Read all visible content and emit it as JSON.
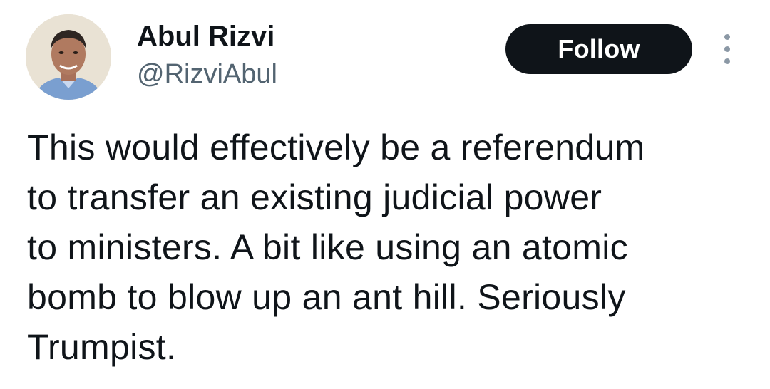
{
  "author": {
    "display_name": "Abul Rizvi",
    "handle": "@RizviAbul",
    "avatar_icon": "profile-photo"
  },
  "actions": {
    "follow_label": "Follow",
    "more_icon": "more-vertical-icon"
  },
  "tweet": {
    "text_lines": [
      "This would effectively be a referendum",
      "to transfer an existing judicial power",
      "to ministers. A bit like using an atomic",
      "bomb to blow up an ant hill. Seriously",
      "Trumpist."
    ]
  },
  "colors": {
    "text_primary": "#0f1419",
    "text_secondary": "#536471",
    "button_bg": "#0f1419",
    "button_text": "#ffffff"
  }
}
